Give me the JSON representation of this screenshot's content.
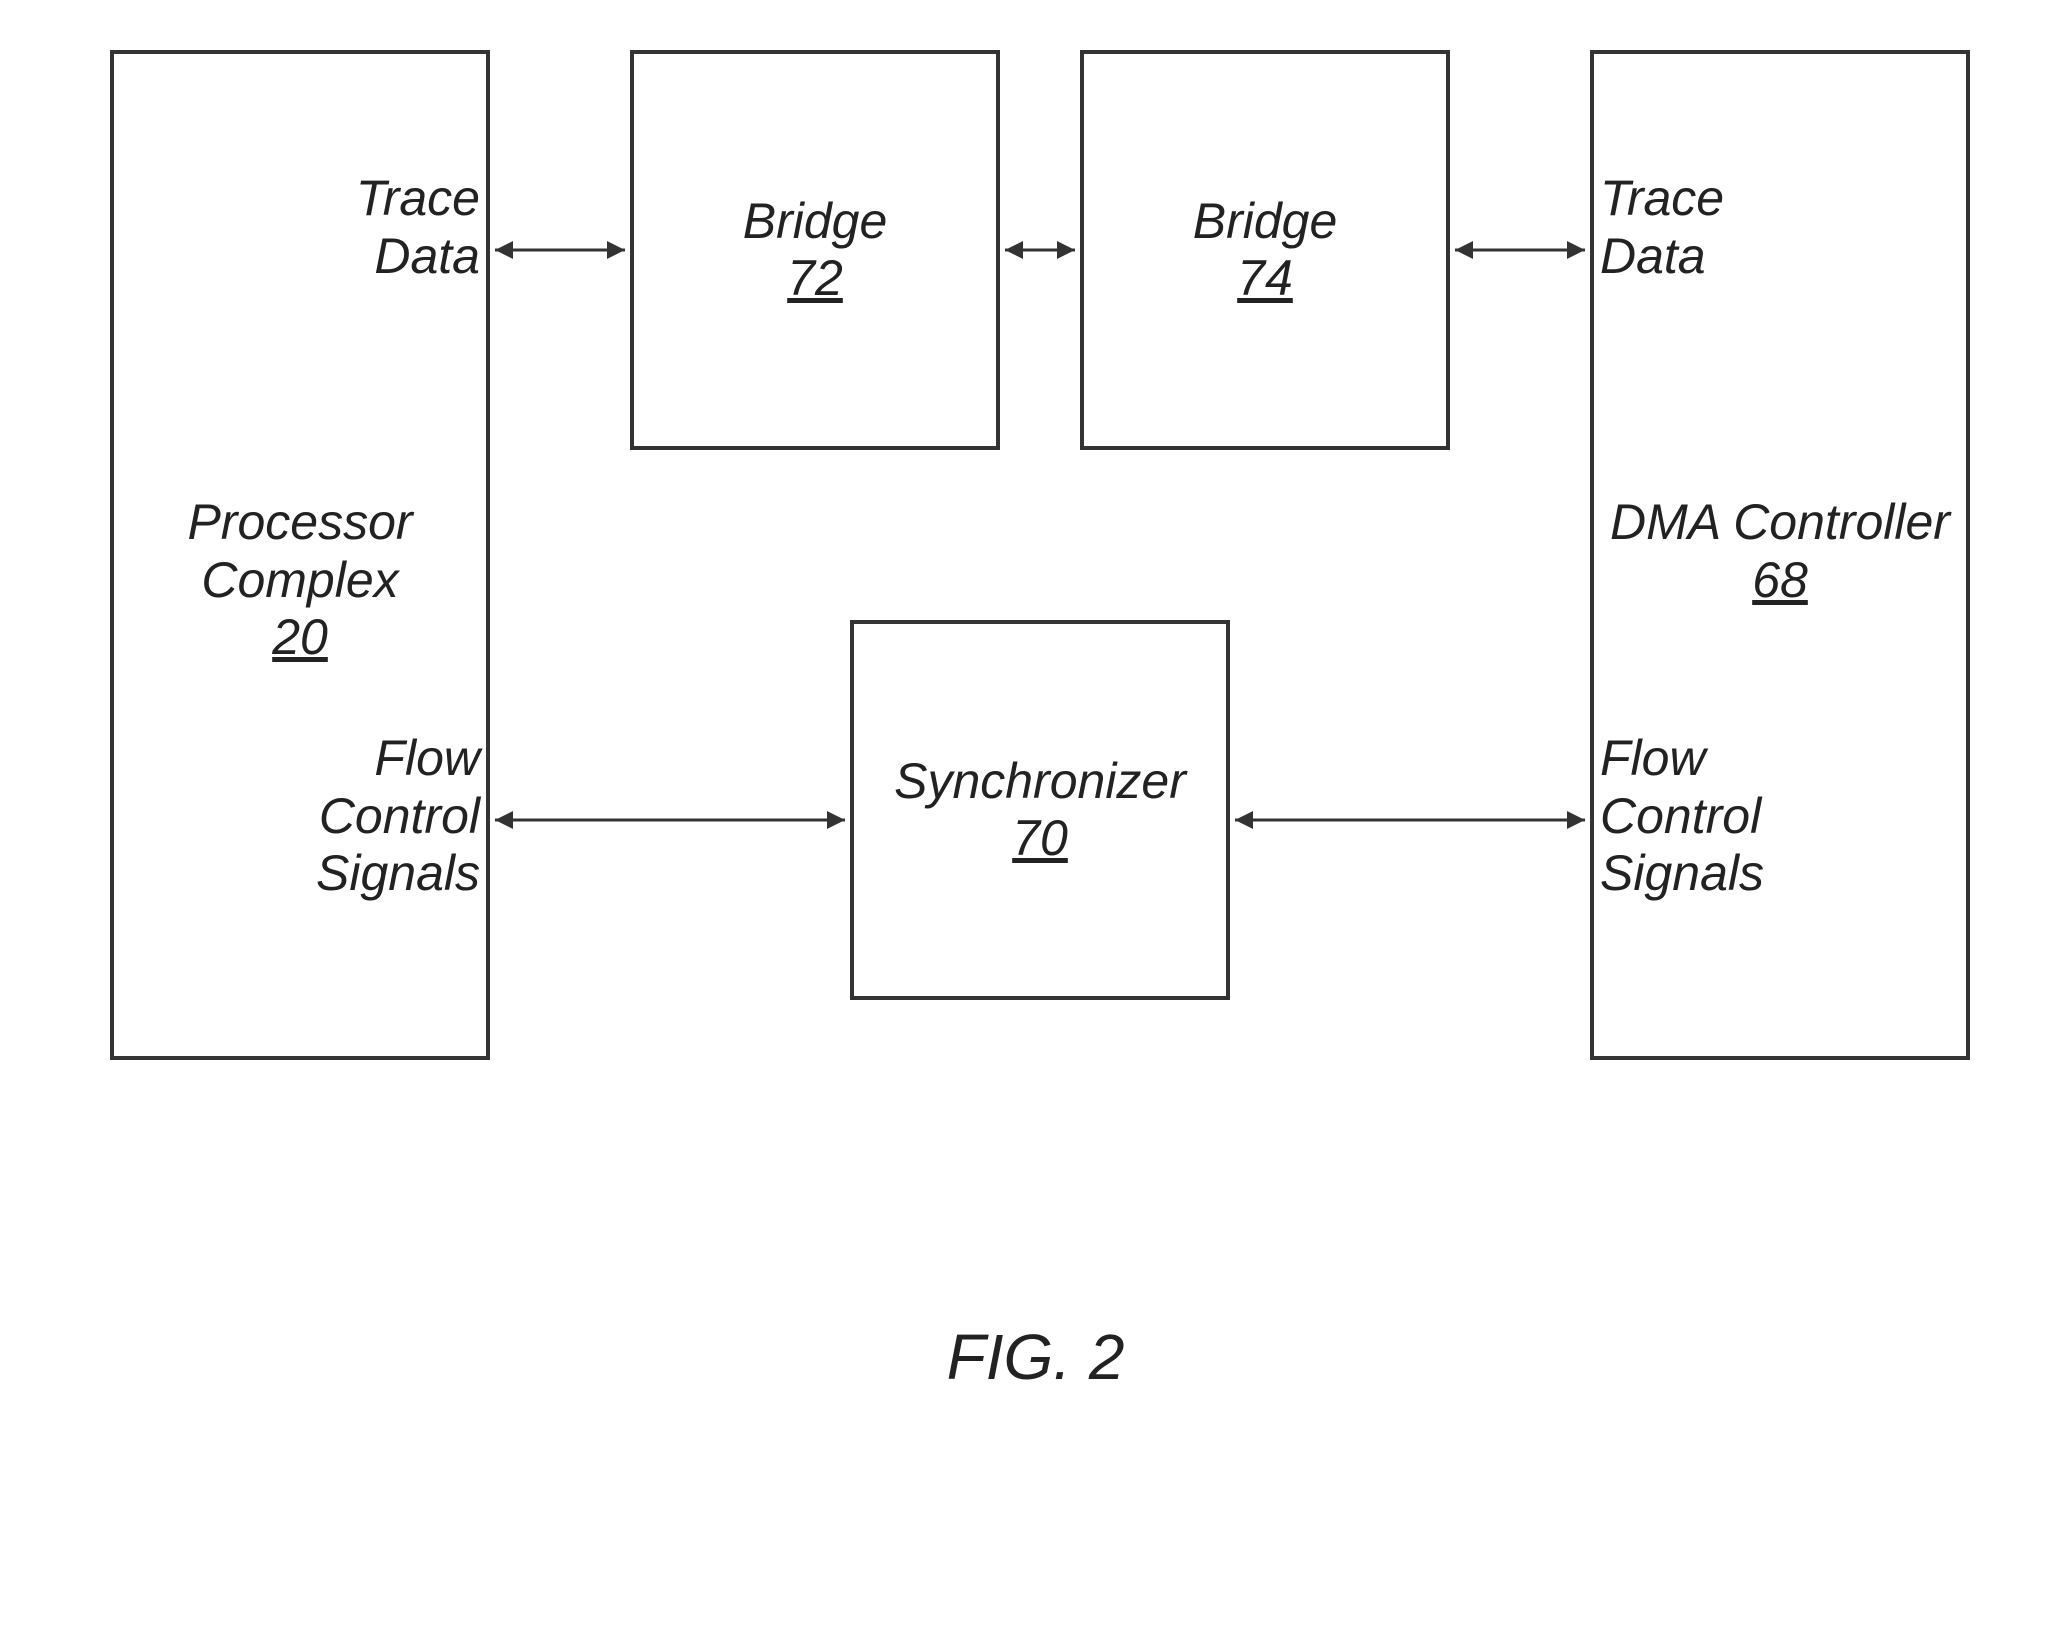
{
  "blocks": {
    "processor": {
      "name": "Processor Complex",
      "ref": "20"
    },
    "bridge1": {
      "name": "Bridge",
      "ref": "72"
    },
    "bridge2": {
      "name": "Bridge",
      "ref": "74"
    },
    "dma": {
      "name": "DMA Controller",
      "ref": "68"
    },
    "sync": {
      "name": "Synchronizer",
      "ref": "70"
    }
  },
  "labels": {
    "traceDataLeft": "Trace Data",
    "traceDataRight": "Trace Data",
    "flowLeft": "Flow Control Signals",
    "flowRight": "Flow Control Signals"
  },
  "figure": "FIG. 2",
  "chart_data": {
    "type": "diagram",
    "nodes": [
      {
        "id": "processor",
        "label": "Processor Complex",
        "ref": "20"
      },
      {
        "id": "bridge72",
        "label": "Bridge",
        "ref": "72"
      },
      {
        "id": "bridge74",
        "label": "Bridge",
        "ref": "74"
      },
      {
        "id": "dma",
        "label": "DMA Controller",
        "ref": "68"
      },
      {
        "id": "sync",
        "label": "Synchronizer",
        "ref": "70"
      }
    ],
    "edges": [
      {
        "from": "processor",
        "to": "bridge72",
        "label": "Trace Data",
        "bidirectional": true
      },
      {
        "from": "bridge72",
        "to": "bridge74",
        "label": "",
        "bidirectional": true
      },
      {
        "from": "bridge74",
        "to": "dma",
        "label": "Trace Data",
        "bidirectional": true
      },
      {
        "from": "processor",
        "to": "sync",
        "label": "Flow Control Signals",
        "bidirectional": true
      },
      {
        "from": "sync",
        "to": "dma",
        "label": "Flow Control Signals",
        "bidirectional": true
      }
    ],
    "caption": "FIG. 2"
  }
}
